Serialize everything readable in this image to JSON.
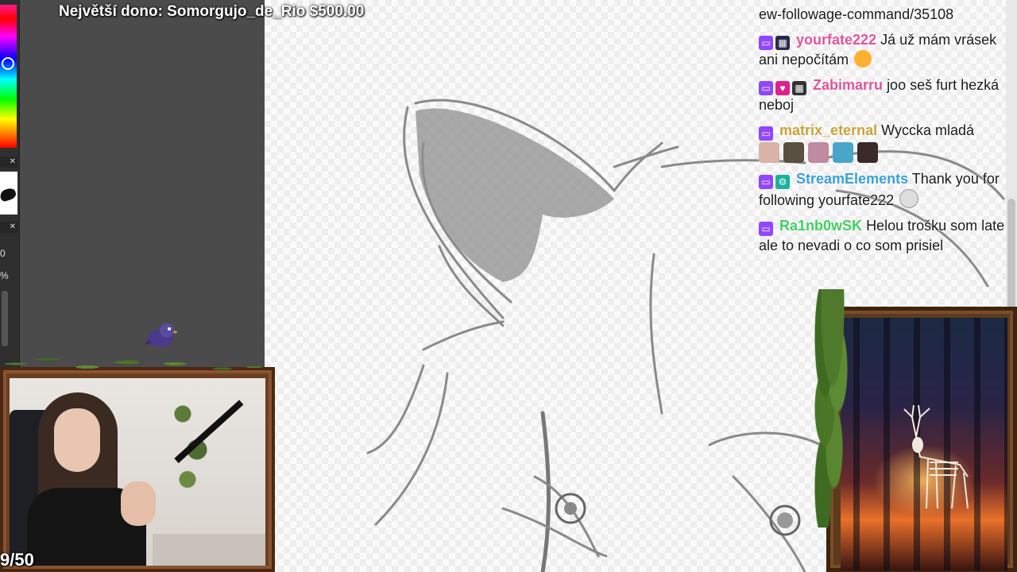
{
  "overlay": {
    "top_donor": "Největší dono: Somorgujo_de_Rio $500.00",
    "goal_counter": "9/50"
  },
  "art_app": {
    "side_values": [
      "0",
      "%"
    ]
  },
  "chat": {
    "lines": [
      {
        "user": "",
        "user_color": "",
        "text": "ew-followage-command/35108",
        "badges": []
      },
      {
        "user": "yourfate222",
        "user_color": "#e0559a",
        "text": "Já už mám vrásek ani nepočítám",
        "badges": [
          "twitch",
          "sub"
        ],
        "emote": "laughing-emoji"
      },
      {
        "user": "Zabimarru",
        "user_color": "#e0559a",
        "text": "joo seš furt hezká neboj",
        "badges": [
          "twitch",
          "heart",
          "grey"
        ]
      },
      {
        "user": "matrix_eternal",
        "user_color": "#c8a23a",
        "text": "Wyccka mladá",
        "badges": [
          "twitch"
        ],
        "emote_row": [
          "emote-girl",
          "emote-well-played",
          "emote-girl-2",
          "emote-blue-hair",
          "emote-dark-hair"
        ]
      },
      {
        "user": "StreamElements",
        "user_color": "#39a0d8",
        "text": "Thank you for following yourfate222",
        "badges": [
          "twitch",
          "bot"
        ],
        "emote": "skull-emoji"
      },
      {
        "user": "Ra1nb0wSK",
        "user_color": "#3fd060",
        "text": "Helou trošku som late ale to nevadi o co som prisiel",
        "badges": [
          "twitch"
        ]
      }
    ]
  },
  "colors": {
    "twitch": "#9146ff",
    "frame_wood": "#6b3f22",
    "leaf": "#4f7a2c"
  }
}
